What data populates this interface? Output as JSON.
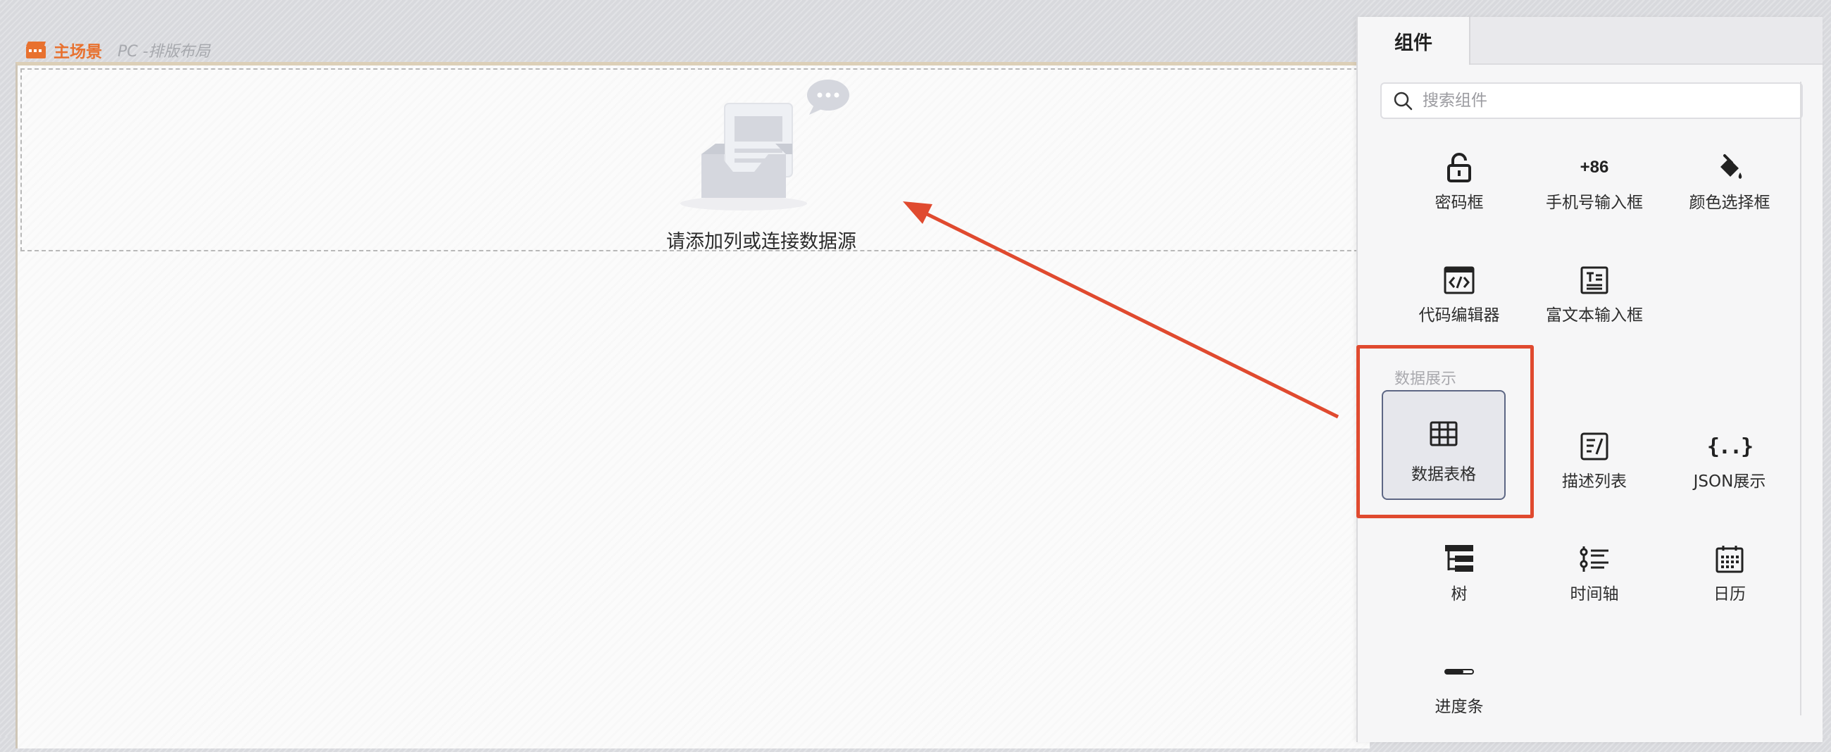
{
  "scene": {
    "title": "主场景",
    "layout": "PC -排版布局"
  },
  "canvas": {
    "empty_text": "请添加列或连接数据源"
  },
  "panel": {
    "tab_label": "组件",
    "search_placeholder": "搜索组件",
    "section_data_display": "数据展示",
    "items": {
      "password": "密码框",
      "phone_input": "手机号输入框",
      "phone_prefix": "+86",
      "color_picker": "颜色选择框",
      "code_editor": "代码编辑器",
      "rich_text": "富文本输入框",
      "data_table": "数据表格",
      "description_list": "描述列表",
      "json_display": "JSON展示",
      "tree": "树",
      "timeline": "时间轴",
      "calendar": "日历",
      "progress": "进度条"
    },
    "selected_item": "数据表格"
  },
  "colors": {
    "accent_orange": "#e8712f",
    "annotation_red": "#e04a2f",
    "selected_border": "#5d6784"
  }
}
